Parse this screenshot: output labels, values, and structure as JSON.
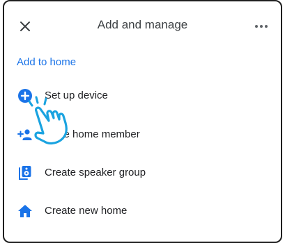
{
  "header": {
    "title": "Add and manage",
    "close_icon": "close-icon",
    "more_icon": "more-horizontal-icon"
  },
  "section": {
    "title": "Add to home"
  },
  "menu": {
    "items": [
      {
        "label": "Set up device",
        "icon": "add-circle-icon"
      },
      {
        "label": "Invite home member",
        "icon": "person-add-icon"
      },
      {
        "label": "Create speaker group",
        "icon": "speaker-group-icon"
      },
      {
        "label": "Create new home",
        "icon": "home-icon"
      }
    ]
  },
  "colors": {
    "accent": "#1a73e8",
    "text": "#202124",
    "hand_outline": "#1aa3e0"
  }
}
